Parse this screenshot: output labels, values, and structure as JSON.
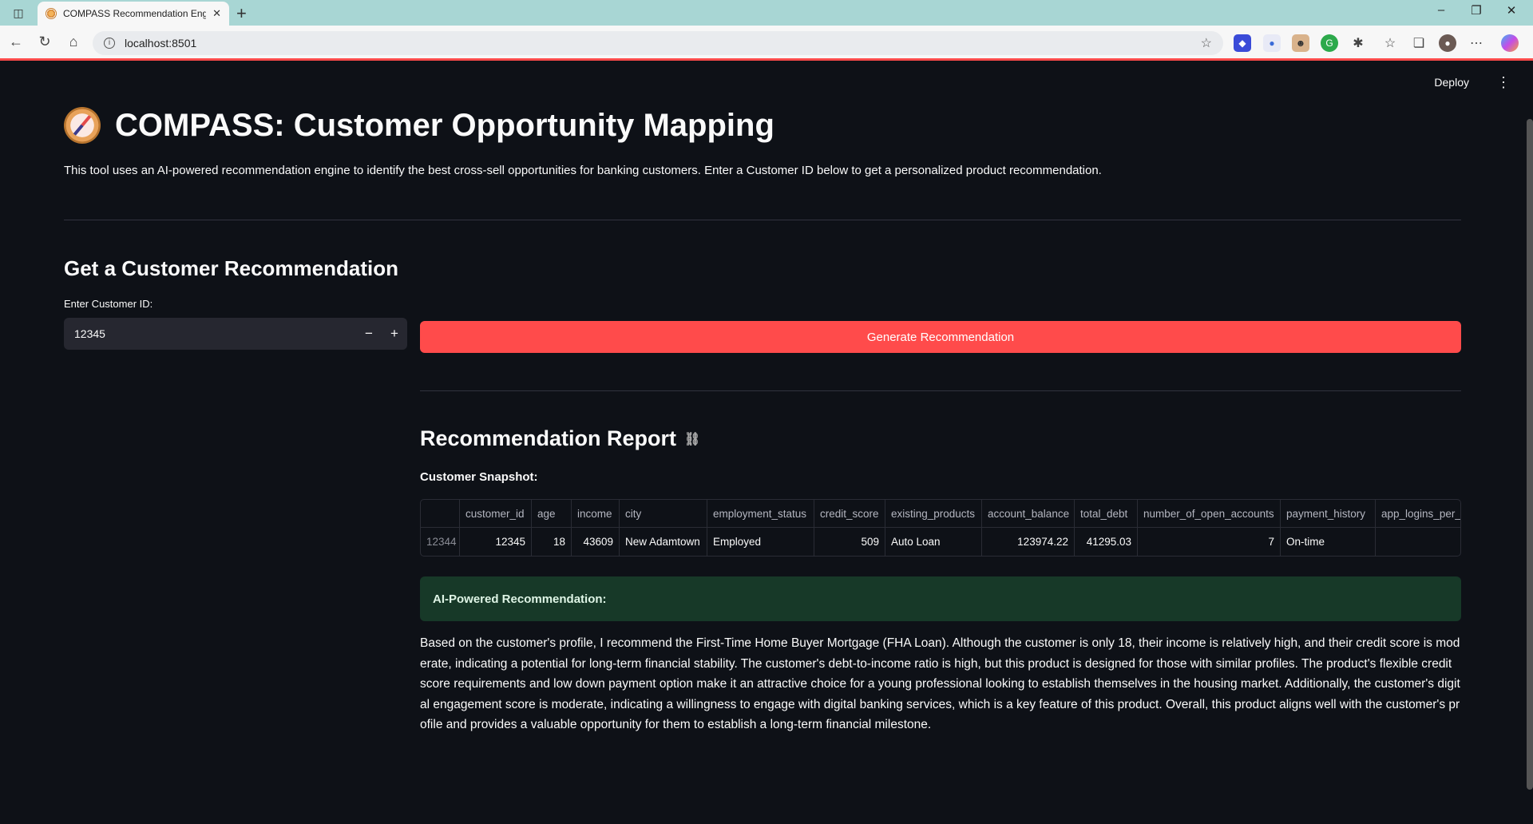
{
  "browser": {
    "tab_title": "COMPASS Recommendation Engi",
    "url": "localhost:8501"
  },
  "app": {
    "deploy_label": "Deploy",
    "title": "COMPASS: Customer Opportunity Mapping",
    "intro": "This tool uses an AI-powered recommendation engine to identify the best cross-sell opportunities for banking customers. Enter a Customer ID below to get a personalized product recommendation.",
    "section_title": "Get a Customer Recommendation",
    "input_label": "Enter Customer ID:",
    "customer_id_value": "12345",
    "stepper_minus": "−",
    "stepper_plus": "+",
    "generate_label": "Generate Recommendation",
    "report_title": "Recommendation Report",
    "snapshot_label": "Customer Snapshot:",
    "table": {
      "headers": [
        "",
        "customer_id",
        "age",
        "income",
        "city",
        "employment_status",
        "credit_score",
        "existing_products",
        "account_balance",
        "total_debt",
        "number_of_open_accounts",
        "payment_history",
        "app_logins_per_"
      ],
      "row": [
        "12344",
        "12345",
        "18",
        "43609",
        "New Adamtown",
        "Employed",
        "509",
        "Auto Loan",
        "123974.22",
        "41295.03",
        "7",
        "On-time",
        ""
      ]
    },
    "ai_label": "AI-Powered Recommendation:",
    "recommendation": "Based on the customer's profile, I recommend the First-Time Home Buyer Mortgage (FHA Loan). Although the customer is only 18, their income is relatively high, and their credit score is moderate, indicating a potential for long-term financial stability. The customer's debt-to-income ratio is high, but this product is designed for those with similar profiles. The product's flexible credit score requirements and low down payment option make it an attractive choice for a young professional looking to establish themselves in the housing market. Additionally, the customer's digital engagement score is moderate, indicating a willingness to engage with digital banking services, which is a key feature of this product. Overall, this product aligns well with the customer's profile and provides a valuable opportunity for them to establish a long-term financial milestone."
  },
  "colors": {
    "background": "#0e1117",
    "primary": "#ff4b4b",
    "success_bg": "#173928"
  }
}
